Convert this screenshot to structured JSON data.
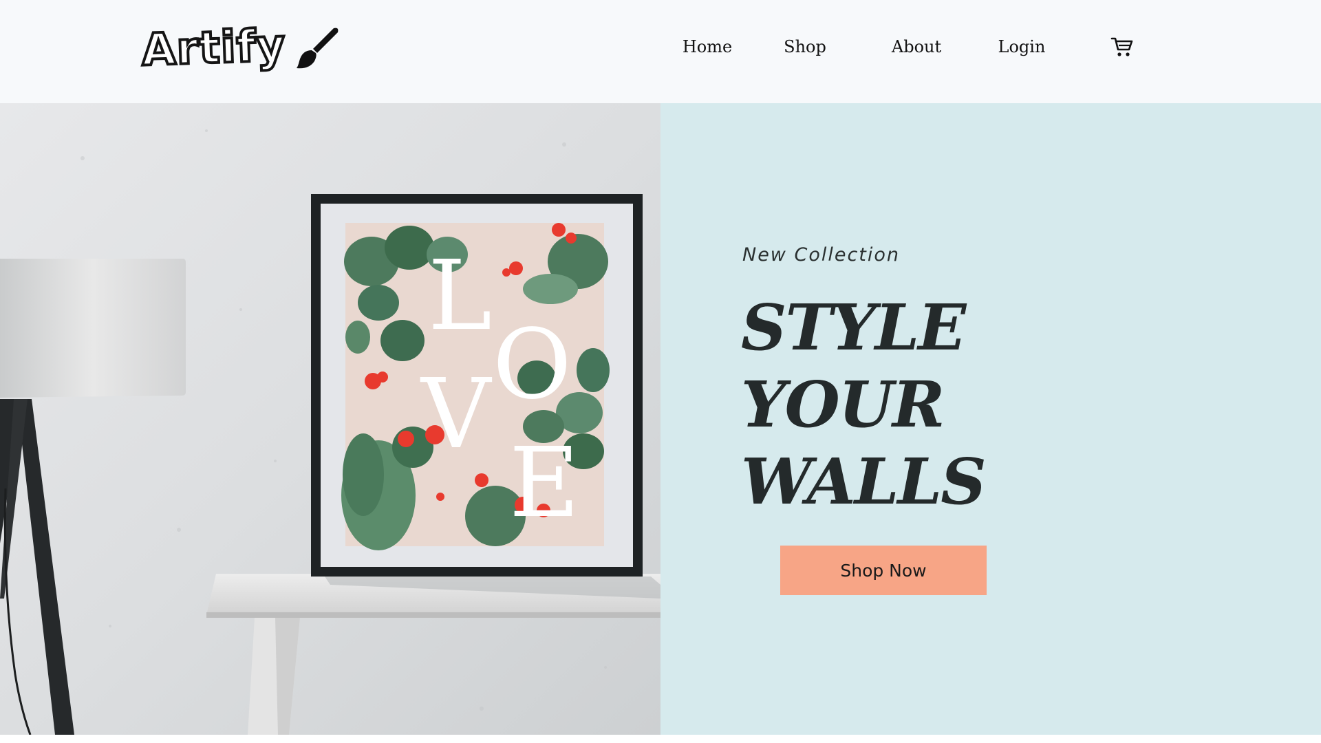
{
  "brand": {
    "name": "Artify",
    "icon": "paintbrush-icon"
  },
  "nav": {
    "home": "Home",
    "shop": "Shop",
    "about": "About",
    "login": "Login",
    "cart_icon": "cart-icon"
  },
  "hero": {
    "eyebrow": "New Collection",
    "headline": [
      "STYLE",
      "YOUR",
      "WALLS"
    ],
    "cta_label": "Shop Now",
    "poster_letters": [
      "L",
      "O",
      "V",
      "E"
    ]
  },
  "colors": {
    "header_bg": "#f7f9fb",
    "hero_right_bg": "#d6eaed",
    "cta_bg": "#f7a586",
    "headline": "#242a2b"
  }
}
